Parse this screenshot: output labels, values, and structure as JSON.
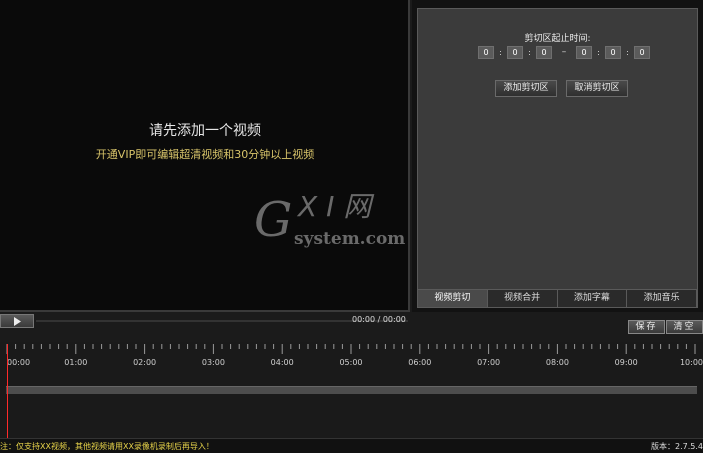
{
  "player": {
    "message_primary": "请先添加一个视频",
    "message_secondary": "开通VIP即可编辑超清视频和30分钟以上视频",
    "watermark_main": "GXI网",
    "watermark_sub": "system.com"
  },
  "trim_panel": {
    "range_label": "剪切区起止时间:",
    "start": [
      "0",
      "0",
      "0"
    ],
    "end": [
      "0",
      "0",
      "0"
    ],
    "separator": ":",
    "range_dash": "–",
    "add_button": "添加剪切区",
    "cancel_button": "取消剪切区"
  },
  "tabs": [
    {
      "label": "视频剪切",
      "active": true
    },
    {
      "label": "视频合并",
      "active": false
    },
    {
      "label": "添加字幕",
      "active": false
    },
    {
      "label": "添加音乐",
      "active": false
    }
  ],
  "controls": {
    "time_display": "00:00 / 00:00",
    "save_button": "保存",
    "clear_button": "清空"
  },
  "timeline": {
    "ticks": [
      "00:00",
      "01:00",
      "02:00",
      "03:00",
      "04:00",
      "05:00",
      "06:00",
      "07:00",
      "08:00",
      "09:00",
      "10:00"
    ]
  },
  "status": {
    "note": "注：仅支持XX视频，其他视频请用XX录像机录制后再导入！",
    "version": "版本：2.7.5.4"
  },
  "colors": {
    "accent_yellow": "#d8c46a",
    "playhead": "#ff2a2a"
  }
}
